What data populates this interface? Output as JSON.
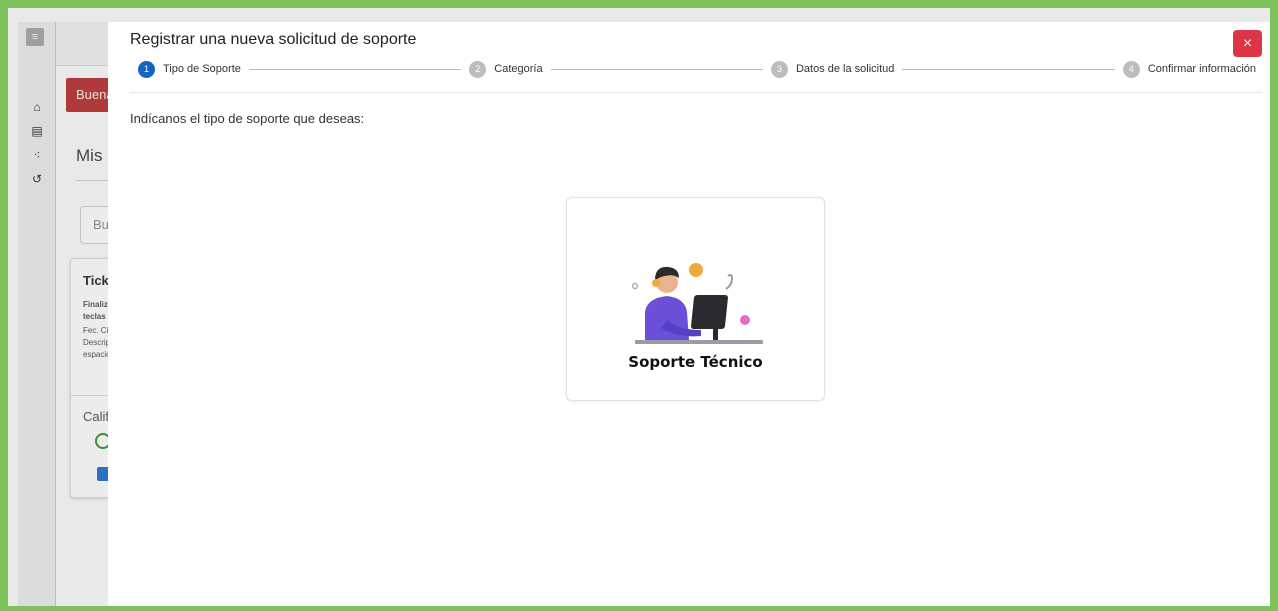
{
  "background": {
    "greeting": "Buena",
    "title": "Mis S",
    "search_placeholder": "Bus",
    "ticket": {
      "title": "Ticke",
      "lines": [
        "Finaliz",
        "teclas",
        "Fec. Ci",
        "Descrip",
        "espacio"
      ],
      "rating_label": "Califi"
    }
  },
  "modal": {
    "title": "Registrar una nueva solicitud de soporte",
    "close_label": "×",
    "steps": [
      {
        "number": "1",
        "label": "Tipo de Soporte",
        "active": true
      },
      {
        "number": "2",
        "label": "Categoría",
        "active": false
      },
      {
        "number": "3",
        "label": "Datos de la solicitud",
        "active": false
      },
      {
        "number": "4",
        "label": "Confirmar información",
        "active": false
      }
    ],
    "prompt": "Indícanos el tipo de soporte que deseas:",
    "options": [
      {
        "label": "Soporte Técnico",
        "icon": "support-agent-illustration"
      }
    ]
  },
  "colors": {
    "frame": "#7dc35a",
    "step_active": "#1565c0",
    "close": "#dc3545",
    "illustration_purple": "#6b4fd8"
  }
}
